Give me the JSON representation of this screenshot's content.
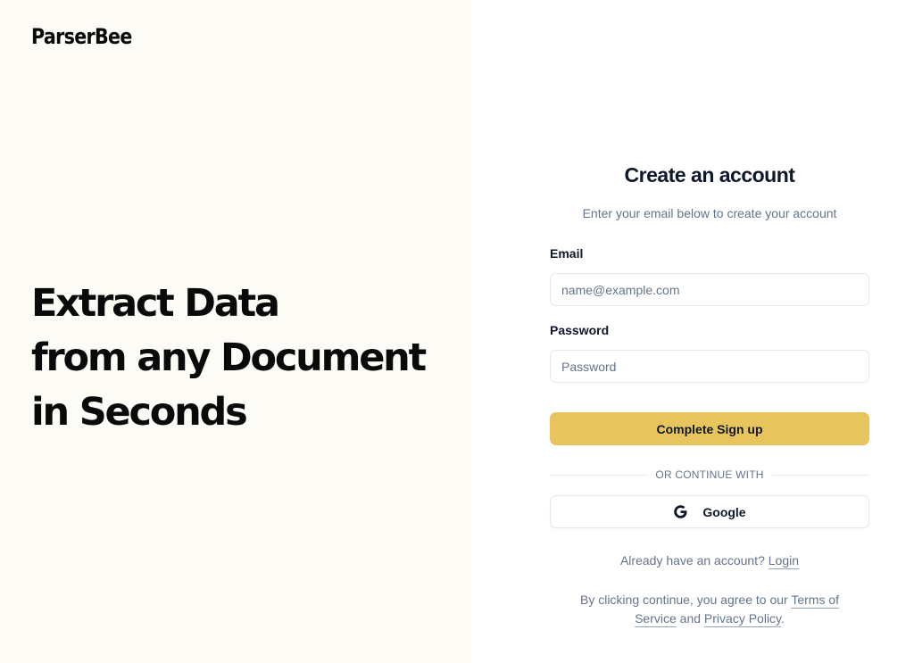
{
  "brand": {
    "name": "ParserBee"
  },
  "hero": {
    "lines": [
      "Extract Data",
      "from any Document",
      "in Seconds"
    ]
  },
  "form": {
    "title": "Create an account",
    "subtitle": "Enter your email below to create your account",
    "email_label": "Email",
    "email_placeholder": "name@example.com",
    "email_value": "",
    "password_label": "Password",
    "password_placeholder": "Password",
    "password_value": "",
    "submit_label": "Complete Sign up",
    "divider_text": "OR CONTINUE WITH",
    "google_label": "Google",
    "google_icon": "google-g-icon",
    "login_prompt": "Already have an account?",
    "login_link": "Login",
    "legal_prefix": "By clicking continue, you agree to our",
    "terms_link": "Terms of Service",
    "legal_and": "and",
    "privacy_link": "Privacy Policy",
    "legal_suffix": "."
  },
  "colors": {
    "left_background": "#fcfbf6",
    "primary_button": "#e8c55c",
    "muted_text": "#64748b",
    "border": "#e2e8f0"
  }
}
